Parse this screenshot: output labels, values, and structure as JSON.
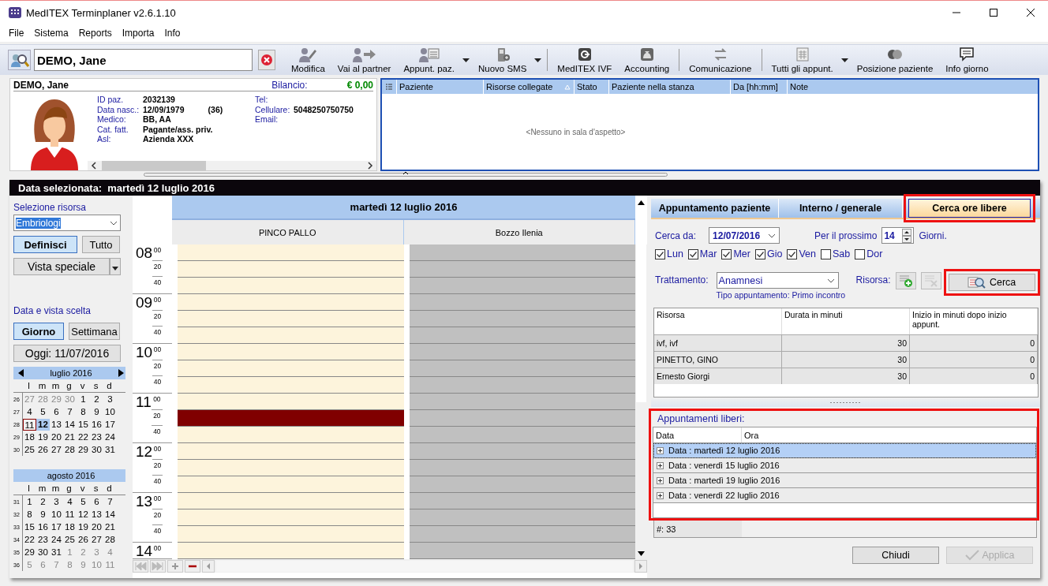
{
  "window": {
    "title": "MedITEX Terminplaner  v2.6.1.10"
  },
  "menu": [
    "File",
    "Sistema",
    "Reports",
    "Importa",
    "Info"
  ],
  "search": {
    "value": "DEMO, Jane"
  },
  "toolbar": {
    "groups": [
      [
        {
          "label": "Modifica",
          "kind": "button"
        },
        {
          "label": "Vai al partner",
          "kind": "button"
        },
        {
          "label": "Appunt. paz.",
          "kind": "dropdown"
        },
        {
          "label": "Nuovo SMS",
          "kind": "dropdown"
        }
      ],
      [
        {
          "label": "MedITEX IVF",
          "kind": "button"
        },
        {
          "label": "Accounting",
          "kind": "button"
        }
      ],
      [
        {
          "label": "Comunicazione",
          "kind": "button"
        }
      ],
      [
        {
          "label": "Tutti gli appunt.",
          "kind": "dropdown"
        },
        {
          "label": "Posizione paziente",
          "kind": "button"
        },
        {
          "label": "Info giorno",
          "kind": "button"
        }
      ]
    ]
  },
  "patient": {
    "name": "DEMO, Jane",
    "balance_label": "Bilancio:",
    "balance": "€ 0,00",
    "fields_left": [
      {
        "label": "ID paz.",
        "value": "2032139"
      },
      {
        "label": "Data nasc.:",
        "value": "12/09/1979",
        "extra": "(36)"
      },
      {
        "label": "Medico:",
        "value": "BB, AA"
      },
      {
        "label": "Cat. fatt.",
        "value": "Pagante/ass. priv."
      },
      {
        "label": "Asl:",
        "value": "Azienda XXX"
      }
    ],
    "fields_right": [
      {
        "label": "Tel:"
      },
      {
        "label": "Cellulare:",
        "value": "5048250750750"
      },
      {
        "label": "Email:"
      }
    ]
  },
  "waiting_room": {
    "columns": [
      {
        "label": "Paziente",
        "sorted": false
      },
      {
        "label": "Risorse collegate",
        "sorted": true
      },
      {
        "label": "Stato",
        "sorted": false
      },
      {
        "label": "Paziente nella stanza",
        "sorted": false
      },
      {
        "label": "Da [hh:mm]",
        "sorted": false
      },
      {
        "label": "Note",
        "sorted": false
      }
    ],
    "empty_text": "<Nessuno in sala d'aspetto>"
  },
  "scheduler": {
    "header_label": "Data selezionata:",
    "header_date": "martedì 12 luglio 2016"
  },
  "left_panel": {
    "resource_label": "Selezione risorsa",
    "resource_value": "Embriologi",
    "resource_buttons": [
      {
        "label": "Definisci",
        "selected": true
      },
      {
        "label": "Tutto",
        "selected": false
      }
    ],
    "special_view": "Vista speciale",
    "view_label": "Data e vista scelta",
    "view_buttons": [
      {
        "label": "Giorno",
        "selected": true
      },
      {
        "label": "Settimana",
        "selected": false
      }
    ],
    "today_button": "Oggi: 11/07/2016",
    "calendars": [
      {
        "title": "luglio 2016",
        "arrows": true,
        "weekdays": [
          "l",
          "m",
          "m",
          "g",
          "v",
          "s",
          "d"
        ],
        "weeks": [
          {
            "week": "26",
            "days": [
              {
                "d": "27",
                "outside": true,
                "today": false,
                "selected": false
              },
              {
                "d": "28",
                "outside": true,
                "today": false,
                "selected": false
              },
              {
                "d": "29",
                "outside": true,
                "today": false,
                "selected": false
              },
              {
                "d": "30",
                "outside": true,
                "today": false,
                "selected": false
              },
              {
                "d": "1",
                "outside": false,
                "today": false,
                "selected": false
              },
              {
                "d": "2",
                "outside": false,
                "today": false,
                "selected": false
              },
              {
                "d": "3",
                "outside": false,
                "today": false,
                "selected": false
              }
            ]
          },
          {
            "week": "27",
            "days": [
              {
                "d": "4",
                "outside": false,
                "today": false,
                "selected": false
              },
              {
                "d": "5",
                "outside": false,
                "today": false,
                "selected": false
              },
              {
                "d": "6",
                "outside": false,
                "today": false,
                "selected": false
              },
              {
                "d": "7",
                "outside": false,
                "today": false,
                "selected": false
              },
              {
                "d": "8",
                "outside": false,
                "today": false,
                "selected": false
              },
              {
                "d": "9",
                "outside": false,
                "today": false,
                "selected": false
              },
              {
                "d": "10",
                "outside": false,
                "today": false,
                "selected": false
              }
            ]
          },
          {
            "week": "28",
            "days": [
              {
                "d": "11",
                "outside": false,
                "today": true,
                "selected": false
              },
              {
                "d": "12",
                "outside": false,
                "today": false,
                "selected": true
              },
              {
                "d": "13",
                "outside": false,
                "today": false,
                "selected": false
              },
              {
                "d": "14",
                "outside": false,
                "today": false,
                "selected": false
              },
              {
                "d": "15",
                "outside": false,
                "today": false,
                "selected": false
              },
              {
                "d": "16",
                "outside": false,
                "today": false,
                "selected": false
              },
              {
                "d": "17",
                "outside": false,
                "today": false,
                "selected": false
              }
            ]
          },
          {
            "week": "29",
            "days": [
              {
                "d": "18",
                "outside": false,
                "today": false,
                "selected": false
              },
              {
                "d": "19",
                "outside": false,
                "today": false,
                "selected": false
              },
              {
                "d": "20",
                "outside": false,
                "today": false,
                "selected": false
              },
              {
                "d": "21",
                "outside": false,
                "today": false,
                "selected": false
              },
              {
                "d": "22",
                "outside": false,
                "today": false,
                "selected": false
              },
              {
                "d": "23",
                "outside": false,
                "today": false,
                "selected": false
              },
              {
                "d": "24",
                "outside": false,
                "today": false,
                "selected": false
              }
            ]
          },
          {
            "week": "30",
            "days": [
              {
                "d": "25",
                "outside": false,
                "today": false,
                "selected": false
              },
              {
                "d": "26",
                "outside": false,
                "today": false,
                "selected": false
              },
              {
                "d": "27",
                "outside": false,
                "today": false,
                "selected": false
              },
              {
                "d": "28",
                "outside": false,
                "today": false,
                "selected": false
              },
              {
                "d": "29",
                "outside": false,
                "today": false,
                "selected": false
              },
              {
                "d": "30",
                "outside": false,
                "today": false,
                "selected": false
              },
              {
                "d": "31",
                "outside": false,
                "today": false,
                "selected": false
              }
            ]
          }
        ]
      },
      {
        "title": "agosto 2016",
        "arrows": false,
        "weekdays": [
          "l",
          "m",
          "m",
          "g",
          "v",
          "s",
          "d"
        ],
        "weeks": [
          {
            "week": "31",
            "days": [
              {
                "d": "1",
                "outside": false,
                "today": false,
                "selected": false
              },
              {
                "d": "2",
                "outside": false,
                "today": false,
                "selected": false
              },
              {
                "d": "3",
                "outside": false,
                "today": false,
                "selected": false
              },
              {
                "d": "4",
                "outside": false,
                "today": false,
                "selected": false
              },
              {
                "d": "5",
                "outside": false,
                "today": false,
                "selected": false
              },
              {
                "d": "6",
                "outside": false,
                "today": false,
                "selected": false
              },
              {
                "d": "7",
                "outside": false,
                "today": false,
                "selected": false
              }
            ]
          },
          {
            "week": "32",
            "days": [
              {
                "d": "8",
                "outside": false,
                "today": false,
                "selected": false
              },
              {
                "d": "9",
                "outside": false,
                "today": false,
                "selected": false
              },
              {
                "d": "10",
                "outside": false,
                "today": false,
                "selected": false
              },
              {
                "d": "11",
                "outside": false,
                "today": false,
                "selected": false
              },
              {
                "d": "12",
                "outside": false,
                "today": false,
                "selected": false
              },
              {
                "d": "13",
                "outside": false,
                "today": false,
                "selected": false
              },
              {
                "d": "14",
                "outside": false,
                "today": false,
                "selected": false
              }
            ]
          },
          {
            "week": "33",
            "days": [
              {
                "d": "15",
                "outside": false,
                "today": false,
                "selected": false
              },
              {
                "d": "16",
                "outside": false,
                "today": false,
                "selected": false
              },
              {
                "d": "17",
                "outside": false,
                "today": false,
                "selected": false
              },
              {
                "d": "18",
                "outside": false,
                "today": false,
                "selected": false
              },
              {
                "d": "19",
                "outside": false,
                "today": false,
                "selected": false
              },
              {
                "d": "20",
                "outside": false,
                "today": false,
                "selected": false
              },
              {
                "d": "21",
                "outside": false,
                "today": false,
                "selected": false
              }
            ]
          },
          {
            "week": "34",
            "days": [
              {
                "d": "22",
                "outside": false,
                "today": false,
                "selected": false
              },
              {
                "d": "23",
                "outside": false,
                "today": false,
                "selected": false
              },
              {
                "d": "24",
                "outside": false,
                "today": false,
                "selected": false
              },
              {
                "d": "25",
                "outside": false,
                "today": false,
                "selected": false
              },
              {
                "d": "26",
                "outside": false,
                "today": false,
                "selected": false
              },
              {
                "d": "27",
                "outside": false,
                "today": false,
                "selected": false
              },
              {
                "d": "28",
                "outside": false,
                "today": false,
                "selected": false
              }
            ]
          },
          {
            "week": "35",
            "days": [
              {
                "d": "29",
                "outside": false,
                "today": false,
                "selected": false
              },
              {
                "d": "30",
                "outside": false,
                "today": false,
                "selected": false
              },
              {
                "d": "31",
                "outside": false,
                "today": false,
                "selected": false
              },
              {
                "d": "1",
                "outside": true,
                "today": false,
                "selected": false
              },
              {
                "d": "2",
                "outside": true,
                "today": false,
                "selected": false
              },
              {
                "d": "3",
                "outside": true,
                "today": false,
                "selected": false
              },
              {
                "d": "4",
                "outside": true,
                "today": false,
                "selected": false
              }
            ]
          },
          {
            "week": "36",
            "days": [
              {
                "d": "5",
                "outside": true,
                "today": false,
                "selected": false
              },
              {
                "d": "6",
                "outside": true,
                "today": false,
                "selected": false
              },
              {
                "d": "7",
                "outside": true,
                "today": false,
                "selected": false
              },
              {
                "d": "8",
                "outside": true,
                "today": false,
                "selected": false
              },
              {
                "d": "9",
                "outside": true,
                "today": false,
                "selected": false
              },
              {
                "d": "10",
                "outside": true,
                "today": false,
                "selected": false
              },
              {
                "d": "11",
                "outside": true,
                "today": false,
                "selected": false
              }
            ]
          }
        ]
      }
    ]
  },
  "day_view": {
    "date": "martedì 12 luglio 2016",
    "hours": [
      {
        "hour": "08",
        "minutes": [
          "00",
          "20",
          "40"
        ]
      },
      {
        "hour": "09",
        "minutes": [
          "00",
          "20",
          "40"
        ]
      },
      {
        "hour": "10",
        "minutes": [
          "00",
          "20",
          "40"
        ]
      },
      {
        "hour": "11",
        "minutes": [
          "00",
          "20",
          "40"
        ]
      },
      {
        "hour": "12",
        "minutes": [
          "00",
          "20",
          "40"
        ]
      },
      {
        "hour": "13",
        "minutes": [
          "00",
          "20",
          "40"
        ]
      },
      {
        "hour": "14",
        "minutes": [
          "00"
        ]
      }
    ],
    "resources": [
      {
        "name": "PINCO PALLO",
        "available": true,
        "slots": [
          {
            "booked": false
          },
          {
            "booked": false
          },
          {
            "booked": false
          },
          {
            "booked": false
          },
          {
            "booked": false
          },
          {
            "booked": false
          },
          {
            "booked": false
          },
          {
            "booked": false
          },
          {
            "booked": false
          },
          {
            "booked": false
          },
          {
            "booked": true
          },
          {
            "booked": false
          },
          {
            "booked": false
          },
          {
            "booked": false
          },
          {
            "booked": false
          },
          {
            "booked": false
          },
          {
            "booked": false
          },
          {
            "booked": false
          },
          {
            "booked": false
          }
        ]
      },
      {
        "name": "Bozzo Ilenia",
        "available": false,
        "slots": [
          {
            "booked": false
          },
          {
            "booked": false
          },
          {
            "booked": false
          },
          {
            "booked": false
          },
          {
            "booked": false
          },
          {
            "booked": false
          },
          {
            "booked": false
          },
          {
            "booked": false
          },
          {
            "booked": false
          },
          {
            "booked": false
          },
          {
            "booked": false
          },
          {
            "booked": false
          },
          {
            "booked": false
          },
          {
            "booked": false
          },
          {
            "booked": false
          },
          {
            "booked": false
          },
          {
            "booked": false
          },
          {
            "booked": false
          },
          {
            "booked": false
          }
        ]
      }
    ]
  },
  "right_panel": {
    "tabs": [
      {
        "label": "Appuntamento paziente",
        "selected": false,
        "highlighted": false
      },
      {
        "label": "Interno / generale",
        "selected": false,
        "highlighted": false
      },
      {
        "label": "Cerca ore libere",
        "selected": true,
        "highlighted": true
      }
    ],
    "search_from_label": "Cerca da:",
    "search_from": "12/07/2016",
    "next_label": "Per il prossimo",
    "next_value": "14",
    "days_label": "Giorni.",
    "weekdays": [
      {
        "label": "Lun",
        "checked": true
      },
      {
        "label": "Mar",
        "checked": true
      },
      {
        "label": "Mer",
        "checked": true
      },
      {
        "label": "Gio",
        "checked": true
      },
      {
        "label": "Ven",
        "checked": true
      },
      {
        "label": "Sab",
        "checked": false
      },
      {
        "label": "Dor",
        "checked": false
      }
    ],
    "treatment_label": "Trattamento:",
    "treatment": "Anamnesi",
    "appointment_type": "Tipo appuntamento: Primo incontro",
    "resource_label": "Risorsa:",
    "search_button": {
      "label": "Cerca",
      "highlighted": true
    },
    "resource_table": {
      "columns": [
        "Risorsa",
        "Durata in minuti",
        "Inizio in minuti dopo inizio appunt."
      ],
      "rows": [
        [
          "ivf, ivf",
          "30",
          "0"
        ],
        [
          "PINETTO, GINO",
          "30",
          "0"
        ],
        [
          "Ernesto Giorgi",
          "30",
          "0"
        ]
      ]
    },
    "free_slots": {
      "title": "Appuntamenti liberi:",
      "highlighted": true,
      "columns": [
        "Data",
        "Ora"
      ],
      "rows": [
        {
          "text": "Data : martedì 12 luglio 2016",
          "selected": true,
          "expanded": false
        },
        {
          "text": "Data : venerdì 15 luglio 2016",
          "selected": false,
          "expanded": false
        },
        {
          "text": "Data : martedì 19 luglio 2016",
          "selected": false,
          "expanded": false
        },
        {
          "text": "Data : venerdì 22 luglio 2016",
          "selected": false,
          "expanded": false
        }
      ],
      "count": "#: 33"
    },
    "buttons": [
      {
        "label": "Chiudi",
        "disabled": false
      },
      {
        "label": "Applica",
        "disabled": true
      }
    ]
  }
}
